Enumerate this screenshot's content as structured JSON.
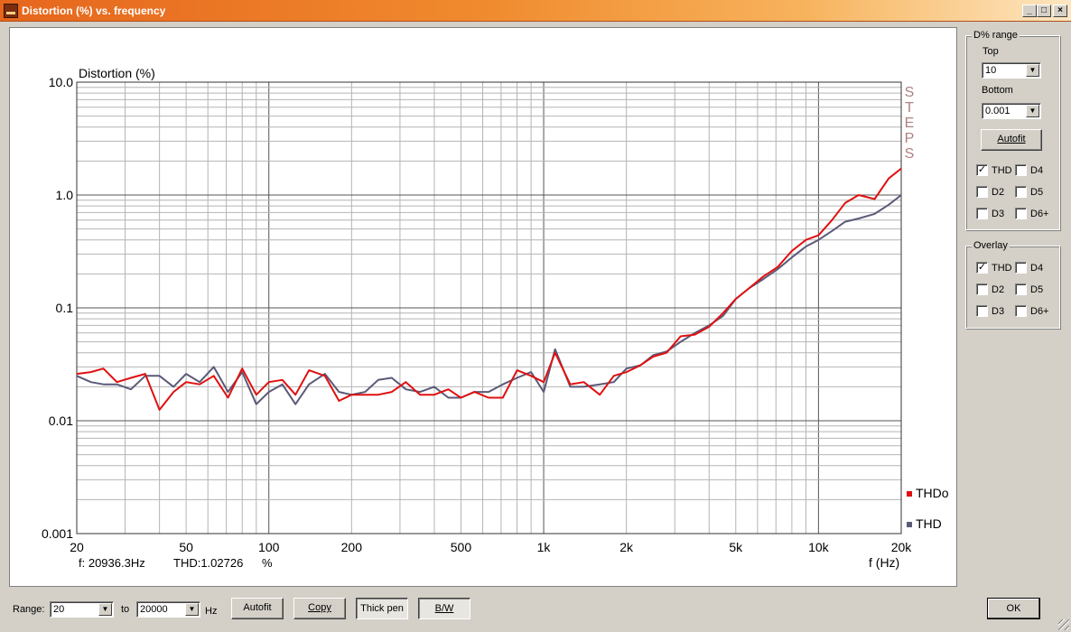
{
  "window": {
    "title": "Distortion (%) vs. frequency",
    "min_btn": "_",
    "max_btn": "□",
    "close_btn": "×"
  },
  "chart_data": {
    "type": "line",
    "ylabel": "Distortion (%)",
    "xlabel": "f (Hz)",
    "x_scale": "log",
    "y_scale": "log",
    "xlim": [
      20,
      20000
    ],
    "ylim": [
      0.001,
      10
    ],
    "x_ticks": [
      {
        "v": 20,
        "label": "20"
      },
      {
        "v": 50,
        "label": "50"
      },
      {
        "v": 100,
        "label": "100"
      },
      {
        "v": 200,
        "label": "200"
      },
      {
        "v": 500,
        "label": "500"
      },
      {
        "v": 1000,
        "label": "1k"
      },
      {
        "v": 2000,
        "label": "2k"
      },
      {
        "v": 5000,
        "label": "5k"
      },
      {
        "v": 10000,
        "label": "10k"
      },
      {
        "v": 20000,
        "label": "20k"
      }
    ],
    "y_ticks": [
      {
        "v": 10,
        "label": "10.0"
      },
      {
        "v": 1,
        "label": "1.0"
      },
      {
        "v": 0.1,
        "label": "0.1"
      },
      {
        "v": 0.01,
        "label": "0.01"
      },
      {
        "v": 0.001,
        "label": "0.001"
      }
    ],
    "grid": true,
    "watermark": "STEPS",
    "legend_position": "bottom-right",
    "readout": {
      "freq": "f: 20936.3Hz",
      "thd": "THD:1.02726",
      "unit": "%"
    },
    "series": [
      {
        "name": "THDo",
        "color": "#e01010",
        "points": [
          [
            20,
            0.026
          ],
          [
            22.5,
            0.027
          ],
          [
            25,
            0.029
          ],
          [
            28,
            0.022
          ],
          [
            31.5,
            0.024
          ],
          [
            35.5,
            0.026
          ],
          [
            40,
            0.0125
          ],
          [
            45,
            0.018
          ],
          [
            50,
            0.022
          ],
          [
            56,
            0.021
          ],
          [
            63,
            0.025
          ],
          [
            71,
            0.016
          ],
          [
            80,
            0.029
          ],
          [
            90,
            0.017
          ],
          [
            100,
            0.022
          ],
          [
            112,
            0.023
          ],
          [
            125,
            0.017
          ],
          [
            140,
            0.028
          ],
          [
            160,
            0.025
          ],
          [
            180,
            0.015
          ],
          [
            200,
            0.017
          ],
          [
            224,
            0.017
          ],
          [
            250,
            0.017
          ],
          [
            280,
            0.018
          ],
          [
            315,
            0.022
          ],
          [
            355,
            0.017
          ],
          [
            400,
            0.017
          ],
          [
            450,
            0.019
          ],
          [
            500,
            0.016
          ],
          [
            560,
            0.018
          ],
          [
            630,
            0.016
          ],
          [
            710,
            0.016
          ],
          [
            800,
            0.028
          ],
          [
            900,
            0.025
          ],
          [
            1000,
            0.022
          ],
          [
            1100,
            0.04
          ],
          [
            1250,
            0.021
          ],
          [
            1400,
            0.022
          ],
          [
            1600,
            0.017
          ],
          [
            1800,
            0.025
          ],
          [
            2000,
            0.027
          ],
          [
            2250,
            0.031
          ],
          [
            2500,
            0.037
          ],
          [
            2800,
            0.04
          ],
          [
            3150,
            0.056
          ],
          [
            3550,
            0.058
          ],
          [
            4000,
            0.068
          ],
          [
            4500,
            0.09
          ],
          [
            5000,
            0.12
          ],
          [
            5600,
            0.15
          ],
          [
            6300,
            0.19
          ],
          [
            7100,
            0.23
          ],
          [
            8000,
            0.32
          ],
          [
            9000,
            0.4
          ],
          [
            10000,
            0.44
          ],
          [
            11200,
            0.6
          ],
          [
            12500,
            0.85
          ],
          [
            14000,
            1.0
          ],
          [
            16000,
            0.92
          ],
          [
            18000,
            1.4
          ],
          [
            20000,
            1.72
          ]
        ]
      },
      {
        "name": "THD",
        "color": "#5a5a78",
        "points": [
          [
            20,
            0.025
          ],
          [
            22.5,
            0.022
          ],
          [
            25,
            0.021
          ],
          [
            28,
            0.021
          ],
          [
            31.5,
            0.019
          ],
          [
            35.5,
            0.025
          ],
          [
            40,
            0.025
          ],
          [
            45,
            0.02
          ],
          [
            50,
            0.026
          ],
          [
            56,
            0.022
          ],
          [
            63,
            0.03
          ],
          [
            71,
            0.018
          ],
          [
            80,
            0.027
          ],
          [
            90,
            0.014
          ],
          [
            100,
            0.018
          ],
          [
            112,
            0.021
          ],
          [
            125,
            0.014
          ],
          [
            140,
            0.021
          ],
          [
            160,
            0.026
          ],
          [
            180,
            0.018
          ],
          [
            200,
            0.017
          ],
          [
            224,
            0.018
          ],
          [
            250,
            0.023
          ],
          [
            280,
            0.024
          ],
          [
            315,
            0.019
          ],
          [
            355,
            0.018
          ],
          [
            400,
            0.02
          ],
          [
            450,
            0.016
          ],
          [
            500,
            0.016
          ],
          [
            560,
            0.018
          ],
          [
            630,
            0.018
          ],
          [
            710,
            0.021
          ],
          [
            800,
            0.024
          ],
          [
            900,
            0.027
          ],
          [
            1000,
            0.018
          ],
          [
            1100,
            0.043
          ],
          [
            1250,
            0.02
          ],
          [
            1400,
            0.02
          ],
          [
            1600,
            0.021
          ],
          [
            1800,
            0.022
          ],
          [
            2000,
            0.029
          ],
          [
            2250,
            0.031
          ],
          [
            2500,
            0.038
          ],
          [
            2800,
            0.041
          ],
          [
            3150,
            0.05
          ],
          [
            3550,
            0.06
          ],
          [
            4000,
            0.07
          ],
          [
            4500,
            0.085
          ],
          [
            5000,
            0.12
          ],
          [
            5600,
            0.15
          ],
          [
            6300,
            0.18
          ],
          [
            7100,
            0.22
          ],
          [
            8000,
            0.28
          ],
          [
            9000,
            0.35
          ],
          [
            10000,
            0.4
          ],
          [
            11200,
            0.48
          ],
          [
            12500,
            0.58
          ],
          [
            14000,
            0.62
          ],
          [
            16000,
            0.68
          ],
          [
            18000,
            0.82
          ],
          [
            20000,
            1.0
          ]
        ]
      }
    ]
  },
  "sidebar": {
    "range_group": {
      "title": "D% range",
      "top_label": "Top",
      "top_value": "10",
      "bottom_label": "Bottom",
      "bottom_value": "0.001",
      "autofit_label": "Autofit"
    },
    "range_checks": [
      {
        "label": "THD",
        "checked": true
      },
      {
        "label": "D4",
        "checked": false
      },
      {
        "label": "D2",
        "checked": false
      },
      {
        "label": "D5",
        "checked": false
      },
      {
        "label": "D3",
        "checked": false
      },
      {
        "label": "D6+",
        "checked": false
      }
    ],
    "overlay_group": {
      "title": "Overlay"
    },
    "overlay_checks": [
      {
        "label": "THD",
        "checked": true
      },
      {
        "label": "D4",
        "checked": false
      },
      {
        "label": "D2",
        "checked": false
      },
      {
        "label": "D5",
        "checked": false
      },
      {
        "label": "D3",
        "checked": false
      },
      {
        "label": "D6+",
        "checked": false
      }
    ]
  },
  "bottombar": {
    "range_label": "Range:",
    "range_from": "20",
    "to_label": "to",
    "range_to": "20000",
    "hz_label": "Hz",
    "autofit_label": "Autofit",
    "copy_label": "Copy",
    "thickpen_label": "Thick pen",
    "bw_label": "B/W",
    "ok_label": "OK"
  }
}
